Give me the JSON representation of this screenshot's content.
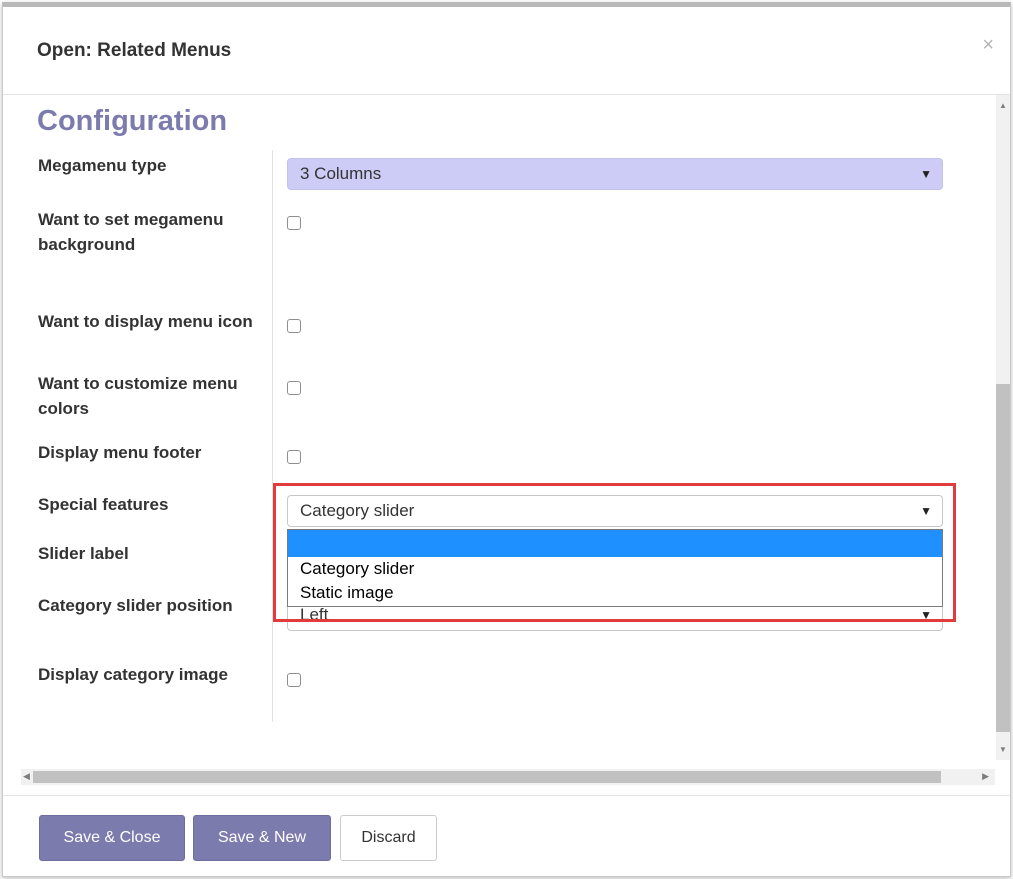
{
  "dialog": {
    "title": "Open: Related Menus",
    "close_symbol": "×"
  },
  "section": {
    "title": "Configuration"
  },
  "fields": {
    "megamenu_type": {
      "label": "Megamenu type",
      "value": "3 Columns"
    },
    "set_background": {
      "label": "Want to set megamenu background",
      "checked": false
    },
    "display_icon": {
      "label": "Want to display menu icon",
      "checked": false
    },
    "customize_colors": {
      "label": "Want to customize menu colors",
      "checked": false
    },
    "display_footer": {
      "label": "Display menu footer",
      "checked": false
    },
    "special_features": {
      "label": "Special features",
      "value": "Category slider"
    },
    "slider_label": {
      "label": "Slider label"
    },
    "slider_position": {
      "label": "Category slider position",
      "value": "Left"
    },
    "display_category_image": {
      "label": "Display category image",
      "checked": false
    }
  },
  "dropdown": {
    "options": [
      "",
      "Category slider",
      "Static image"
    ]
  },
  "footer": {
    "save_close": "Save & Close",
    "save_new": "Save & New",
    "discard": "Discard"
  },
  "icons": {
    "caret": "▼",
    "scroll_up": "▲",
    "scroll_down": "▼",
    "scroll_left": "◀",
    "scroll_right": "▶"
  },
  "colors": {
    "accent": "#7c7bad",
    "select_highlight": "#ccccf7",
    "dropdown_selected": "#1e90ff",
    "annotation_box": "#e03c3c"
  }
}
